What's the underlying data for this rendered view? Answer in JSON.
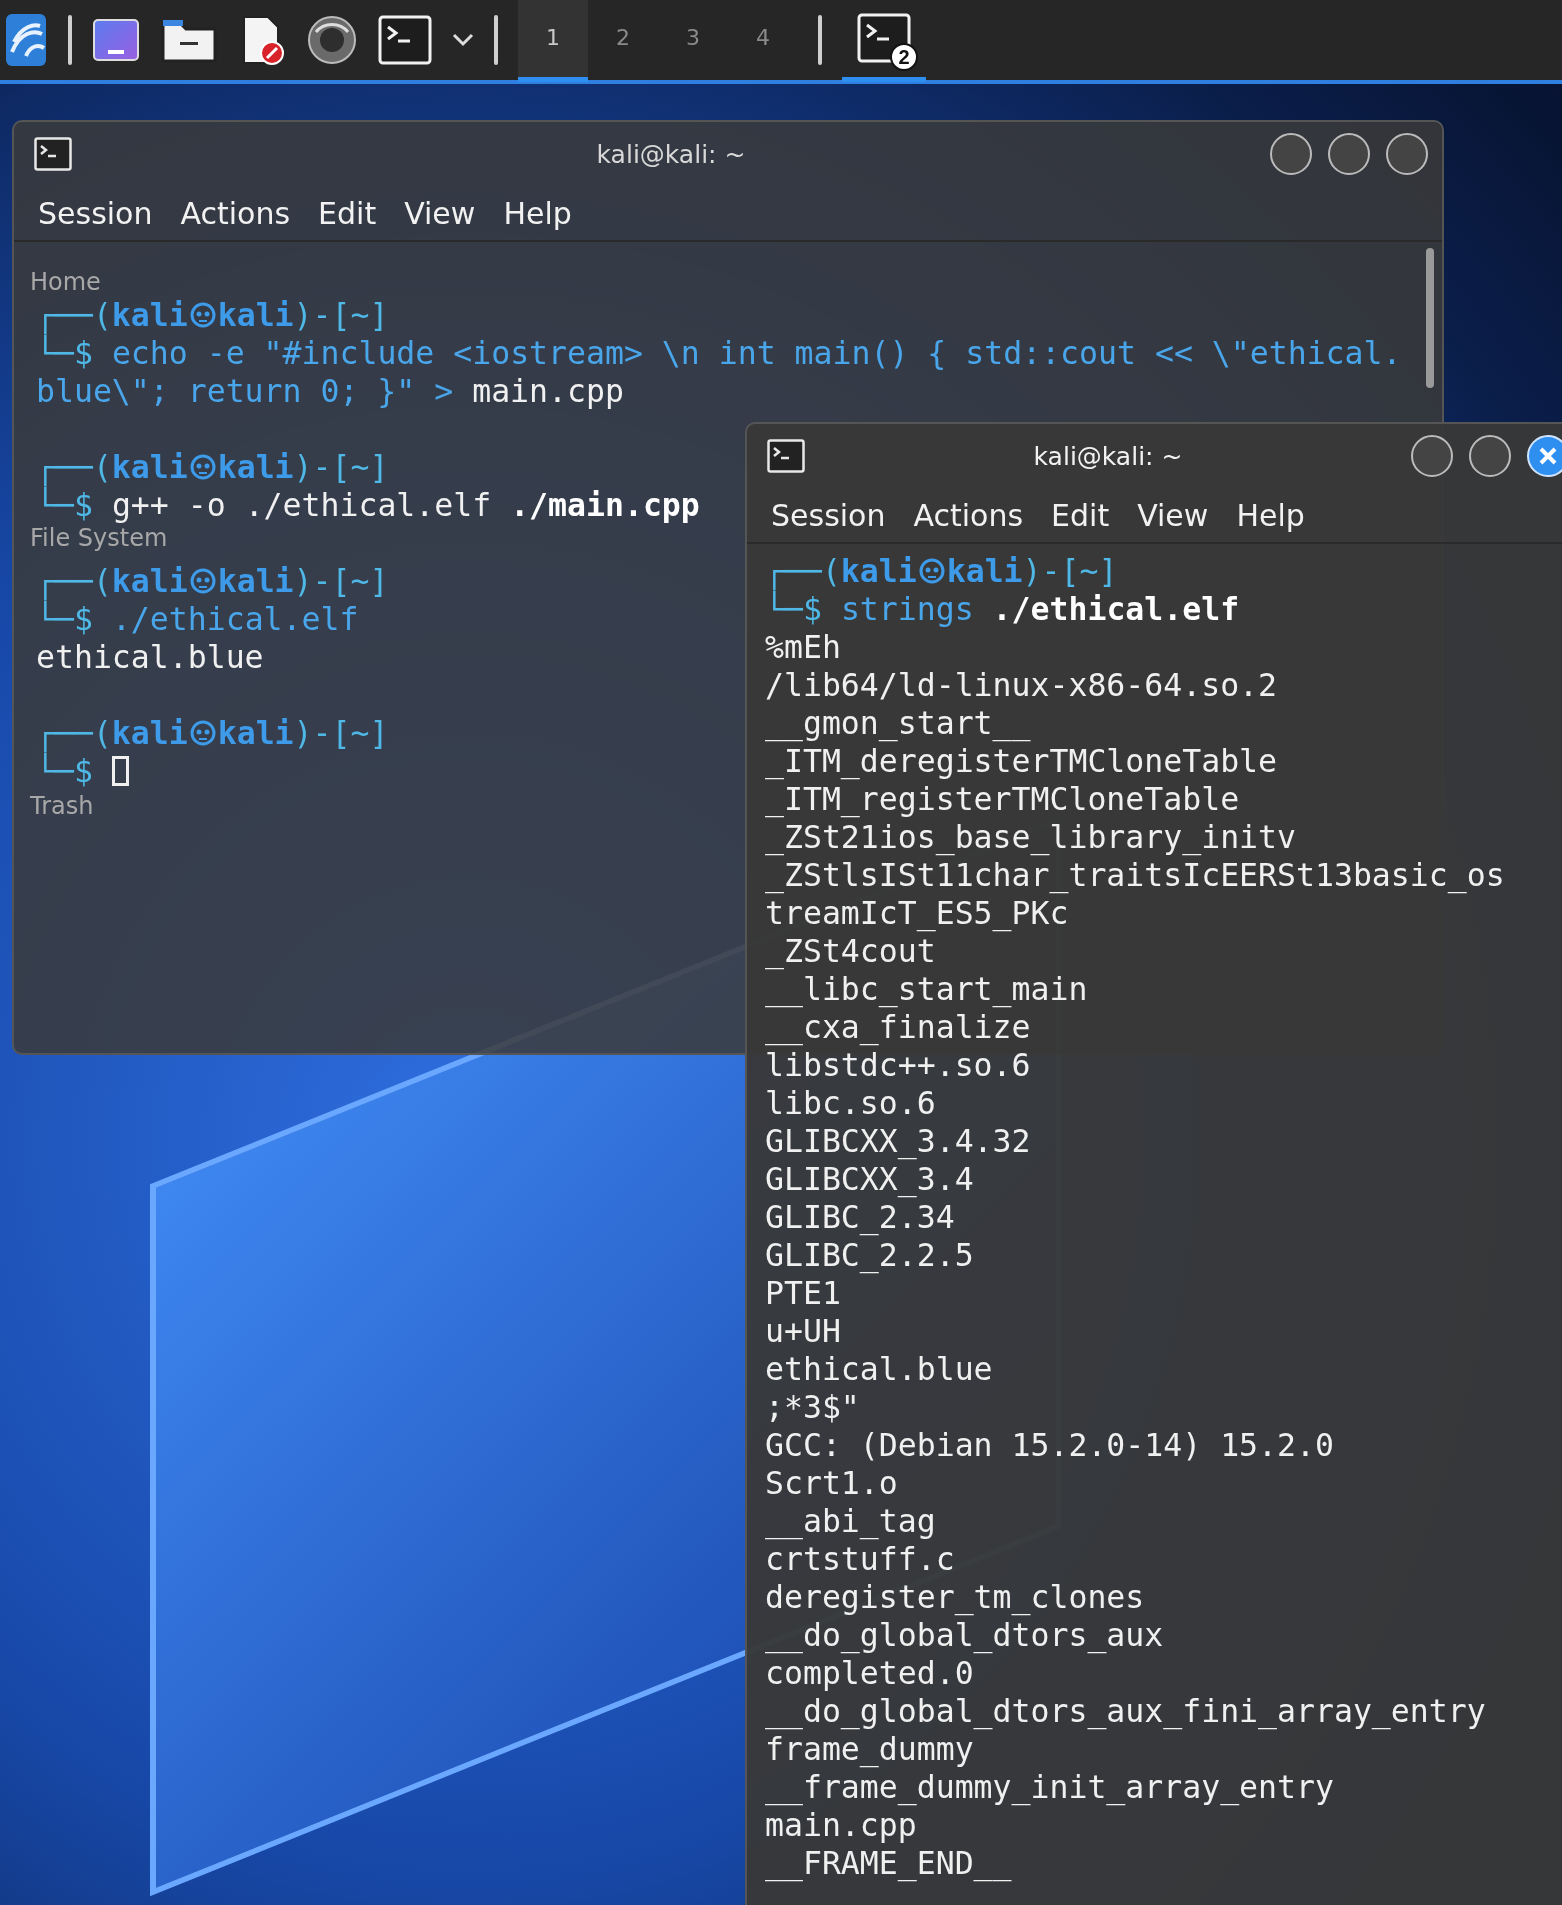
{
  "taskbar": {
    "launchers": [
      {
        "kind": "menu"
      },
      {
        "kind": "desktop"
      },
      {
        "kind": "folder"
      },
      {
        "kind": "editor"
      },
      {
        "kind": "browser"
      },
      {
        "kind": "terminal"
      },
      {
        "kind": "caret"
      }
    ],
    "workspaces": [
      {
        "label": "1",
        "selected": true
      },
      {
        "label": "2",
        "selected": false
      },
      {
        "label": "3",
        "selected": false
      },
      {
        "label": "4",
        "selected": false
      }
    ],
    "task": {
      "badge": "2",
      "selected": true
    }
  },
  "desktop_icons": [
    {
      "label": "Home"
    },
    {
      "label": "File System"
    },
    {
      "label": "Trash"
    }
  ],
  "windows": [
    {
      "title": "kali@kali: ~",
      "active": false,
      "menu": [
        "Session",
        "Actions",
        "Edit",
        "View",
        "Help"
      ],
      "lines": [
        {
          "kind": "prompt",
          "head_before": "┌──(",
          "user": "kali",
          "host": "kali",
          "head_after": ")-[~]",
          "marker": "└─$",
          "cursor": false,
          "command": [
            {
              "text": "echo -e \"#include <iostream> \\n int main() { std::cout << \\\"ethical.blue\\\"; return 0; }\" > ",
              "kind": "cmd"
            },
            {
              "text": "main.cpp",
              "kind": "plain"
            }
          ]
        },
        {
          "kind": "blank"
        },
        {
          "kind": "prompt",
          "head_before": "┌──(",
          "user": "kali",
          "host": "kali",
          "head_after": ")-[~]",
          "marker": "└─$",
          "cursor": false,
          "command": [
            {
              "text": "g++ -o ./ethical.elf ",
              "kind": "plain"
            },
            {
              "text": "./main.cpp",
              "kind": "bold"
            }
          ]
        },
        {
          "kind": "blank"
        },
        {
          "kind": "prompt",
          "head_before": "┌──(",
          "user": "kali",
          "host": "kali",
          "head_after": ")-[~]",
          "marker": "└─$",
          "cursor": false,
          "command": [
            {
              "text": "./ethical.elf",
              "kind": "cmd"
            }
          ]
        },
        {
          "kind": "output",
          "text": "ethical.blue"
        },
        {
          "kind": "blank"
        },
        {
          "kind": "prompt",
          "head_before": "┌──(",
          "user": "kali",
          "host": "kali",
          "head_after": ")-[~]",
          "marker": "└─$",
          "cursor": true
        }
      ]
    },
    {
      "title": "kali@kali: ~",
      "active": true,
      "menu": [
        "Session",
        "Actions",
        "Edit",
        "View",
        "Help"
      ],
      "lines": [
        {
          "kind": "prompt",
          "head_before": "┌──(",
          "user": "kali",
          "host": "kali",
          "head_after": ")-[~]",
          "marker": "└─$",
          "cursor": false,
          "command": [
            {
              "text": "strings ",
              "kind": "cmd"
            },
            {
              "text": "./ethical.elf",
              "kind": "bold"
            }
          ]
        },
        {
          "kind": "output",
          "text": "%mEh"
        },
        {
          "kind": "output",
          "text": "/lib64/ld-linux-x86-64.so.2"
        },
        {
          "kind": "output",
          "text": "__gmon_start__"
        },
        {
          "kind": "output",
          "text": "_ITM_deregisterTMCloneTable"
        },
        {
          "kind": "output",
          "text": "_ITM_registerTMCloneTable"
        },
        {
          "kind": "output",
          "text": "_ZSt21ios_base_library_initv"
        },
        {
          "kind": "output",
          "text": "_ZStlsISt11char_traitsIcEERSt13basic_os"
        },
        {
          "kind": "output",
          "text": "treamIcT_ES5_PKc"
        },
        {
          "kind": "output",
          "text": "_ZSt4cout"
        },
        {
          "kind": "output",
          "text": "__libc_start_main"
        },
        {
          "kind": "output",
          "text": "__cxa_finalize"
        },
        {
          "kind": "output",
          "text": "libstdc++.so.6"
        },
        {
          "kind": "output",
          "text": "libc.so.6"
        },
        {
          "kind": "output",
          "text": "GLIBCXX_3.4.32"
        },
        {
          "kind": "output",
          "text": "GLIBCXX_3.4"
        },
        {
          "kind": "output",
          "text": "GLIBC_2.34"
        },
        {
          "kind": "output",
          "text": "GLIBC_2.2.5"
        },
        {
          "kind": "output",
          "text": "PTE1"
        },
        {
          "kind": "output",
          "text": "u+UH"
        },
        {
          "kind": "output",
          "text": "ethical.blue"
        },
        {
          "kind": "output",
          "text": ";*3$\""
        },
        {
          "kind": "output",
          "text": "GCC: (Debian 15.2.0-14) 15.2.0"
        },
        {
          "kind": "output",
          "text": "Scrt1.o"
        },
        {
          "kind": "output",
          "text": "__abi_tag"
        },
        {
          "kind": "output",
          "text": "crtstuff.c"
        },
        {
          "kind": "output",
          "text": "deregister_tm_clones"
        },
        {
          "kind": "output",
          "text": "__do_global_dtors_aux"
        },
        {
          "kind": "output",
          "text": "completed.0"
        },
        {
          "kind": "output",
          "text": "__do_global_dtors_aux_fini_array_entry"
        },
        {
          "kind": "output",
          "text": "frame_dummy"
        },
        {
          "kind": "output",
          "text": "__frame_dummy_init_array_entry"
        },
        {
          "kind": "output",
          "text": "main.cpp"
        },
        {
          "kind": "output",
          "text": "__FRAME_END__"
        }
      ]
    }
  ]
}
